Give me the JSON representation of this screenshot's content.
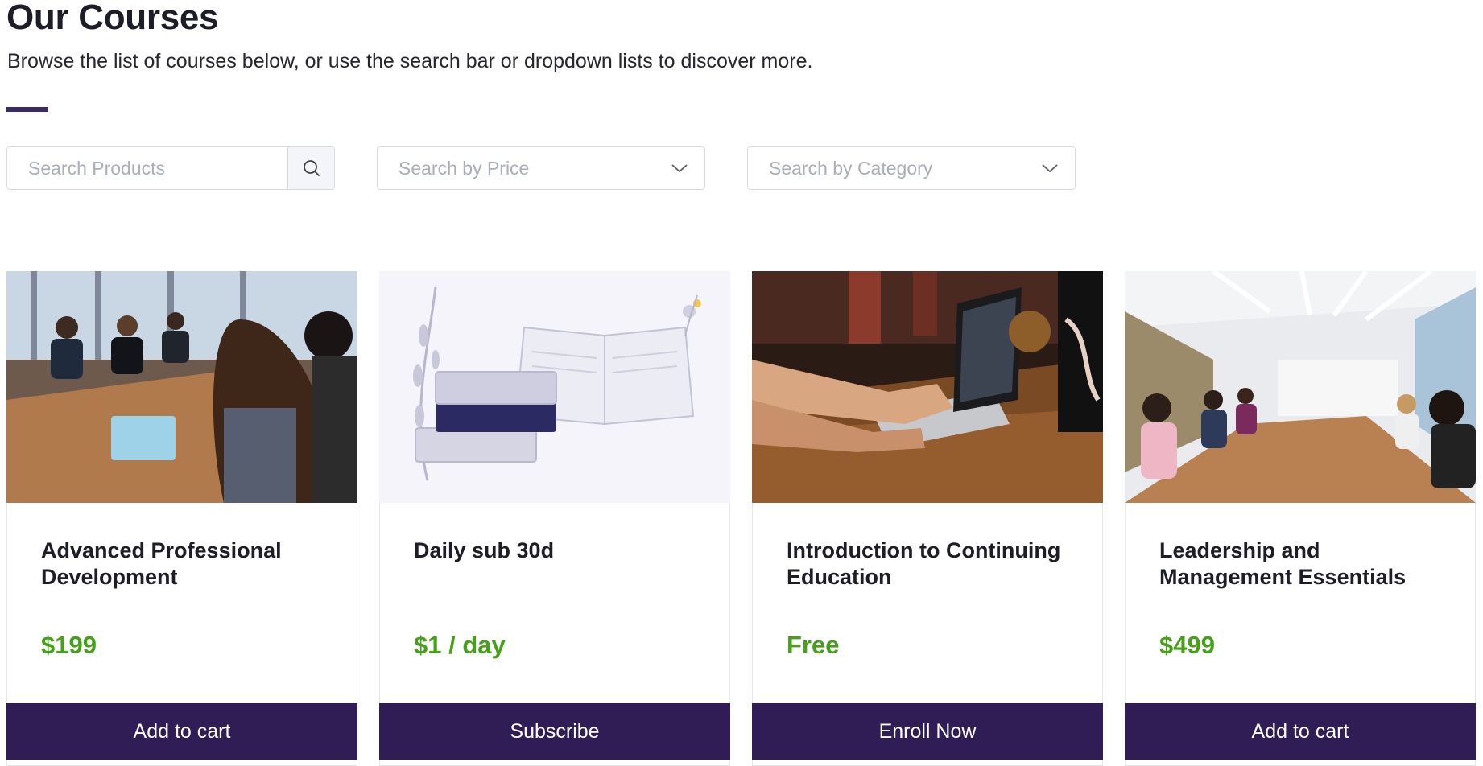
{
  "header": {
    "title": "Our Courses",
    "subtitle": "Browse the list of courses below, or use the search bar or dropdown lists to discover more."
  },
  "filters": {
    "search_placeholder": "Search Products",
    "price_placeholder": "Search by Price",
    "category_placeholder": "Search by Category"
  },
  "courses": [
    {
      "title": "Advanced Professional Development",
      "price": "$199",
      "button": "Add to cart",
      "image": "office-meeting-photo"
    },
    {
      "title": "Daily sub 30d",
      "price": "$1 / day",
      "button": "Subscribe",
      "image": "books-illustration"
    },
    {
      "title": "Introduction to Continuing Education",
      "price": "Free",
      "button": "Enroll Now",
      "image": "laptop-typing-photo"
    },
    {
      "title": "Leadership and Management Essentials",
      "price": "$499",
      "button": "Add to cart",
      "image": "conference-room-photo"
    }
  ],
  "colors": {
    "accent": "#3a2a65",
    "button": "#311d56",
    "price": "#46a01a"
  }
}
